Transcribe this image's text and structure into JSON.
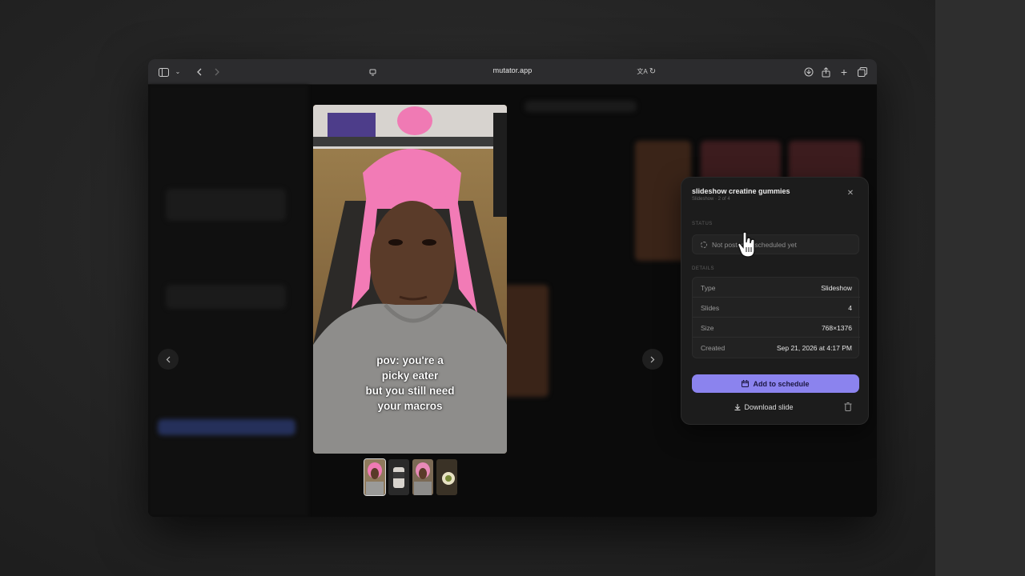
{
  "browser": {
    "url": "mutator.app"
  },
  "viewer": {
    "caption_lines": [
      "pov: you're a",
      "picky eater",
      "but you still need",
      "your macros"
    ],
    "thumbnail_count": 4,
    "active_thumbnail": 1
  },
  "panel": {
    "title": "slideshow creatine gummies",
    "subtitle": "Slideshow · 2 of 4",
    "close_icon": "close-icon",
    "status_heading": "STATUS",
    "status_text": "Not posted or scheduled yet",
    "details_heading": "DETAILS",
    "details": [
      {
        "label": "Type",
        "value": "Slideshow"
      },
      {
        "label": "Slides",
        "value": "4"
      },
      {
        "label": "Size",
        "value": "768×1376"
      },
      {
        "label": "Created",
        "value": "Sep 21, 2026 at 4:17 PM"
      }
    ],
    "primary_button": "Add to schedule",
    "secondary_button": "Download slide",
    "colors": {
      "accent": "#8b83ee",
      "panel_bg": "#1c1c1c"
    }
  }
}
